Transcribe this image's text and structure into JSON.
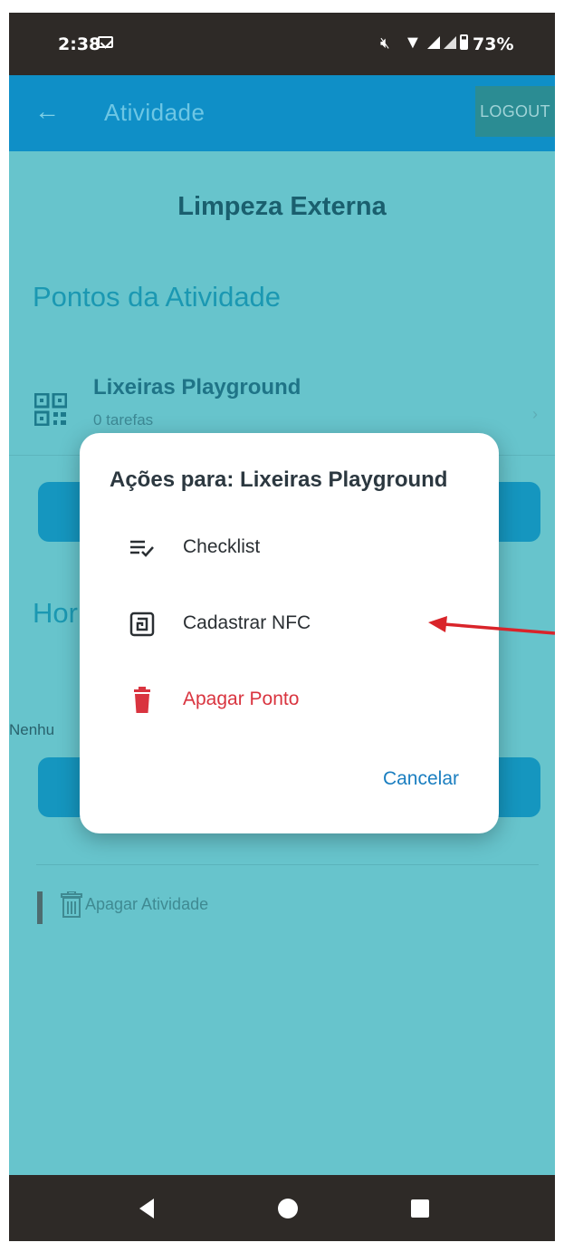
{
  "status_bar": {
    "time": "2:38",
    "battery": "73%",
    "icons": [
      "mail-icon",
      "mute-icon",
      "wifi-icon",
      "signal-icon",
      "battery-icon"
    ]
  },
  "app_bar": {
    "title": "Atividade",
    "logout_label": "LOGOUT",
    "color": "#0f8fc7"
  },
  "page": {
    "activity_title": "Limpeza Externa",
    "points_section_title": "Pontos da Atividade",
    "point": {
      "name": "Lixeiras Playground",
      "tasks": "0 tarefas"
    },
    "hours_section_title": "Hor",
    "no_hours_text": "Nenhu",
    "delete_activity_label": "Apagar Atividade"
  },
  "dialog": {
    "title": "Ações para: Lixeiras Playground",
    "actions": [
      {
        "icon": "checklist-icon",
        "label": "Checklist"
      },
      {
        "icon": "nfc-icon",
        "label": "Cadastrar NFC"
      },
      {
        "icon": "trash-icon",
        "label": "Apagar Ponto",
        "color": "#d9343f"
      }
    ],
    "cancel_label": "Cancelar"
  },
  "nav_bar": {
    "icons": [
      "back-icon",
      "home-icon",
      "recents-icon"
    ]
  },
  "colors": {
    "background_dim": "#67c4cc",
    "danger": "#d9343f",
    "link": "#1a7ec0",
    "annotation": "#d9242a"
  }
}
